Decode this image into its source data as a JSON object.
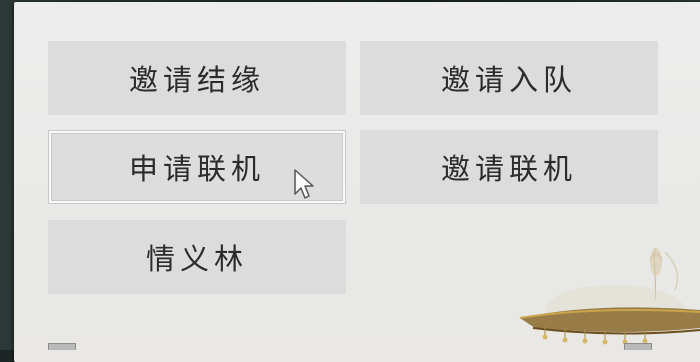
{
  "menu": {
    "invite_bond": "邀请结缘",
    "invite_team": "邀请入队",
    "request_coop": "申请联机",
    "invite_coop": "邀请联机",
    "friendship_grove": "情义林"
  },
  "colors": {
    "panel": "#ebebeb",
    "button": "#dcdcdc",
    "text": "#2b2b2b",
    "backdrop": "#1c2424"
  },
  "icons": [
    "mouse-cursor-icon",
    "boat-decoration-icon"
  ]
}
